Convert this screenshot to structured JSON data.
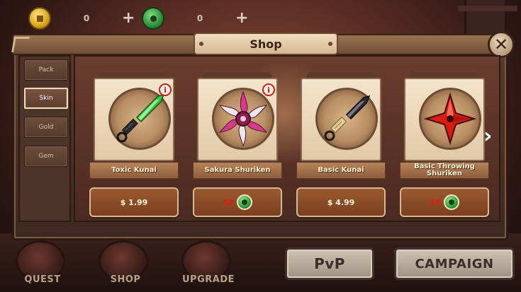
{
  "resources": {
    "coins": "0",
    "gems": "0",
    "coin_icon": "gold-coin-icon",
    "gem_icon": "jade-coin-icon",
    "plus": "+"
  },
  "shop": {
    "title": "Shop",
    "close": "✕",
    "tabs": [
      {
        "label": "Pack",
        "active": false
      },
      {
        "label": "Skin",
        "active": true
      },
      {
        "label": "Gold",
        "active": false
      },
      {
        "label": "Gem",
        "active": false
      }
    ],
    "items": [
      {
        "name": "Toxic Kunai",
        "price": "$ 1.99",
        "currency": "usd",
        "info": "i",
        "icon": "toxic-kunai-icon"
      },
      {
        "name": "Sakura Shuriken",
        "price": "50",
        "currency": "jade",
        "info": "i",
        "icon": "sakura-shuriken-icon"
      },
      {
        "name": "Basic Kunai",
        "price": "$ 4.99",
        "currency": "usd",
        "icon": "basic-kunai-icon"
      },
      {
        "name": "Basic Throwing Shuriken",
        "price": "25",
        "currency": "jade",
        "icon": "basic-shuriken-icon"
      }
    ],
    "next_arrow": "›"
  },
  "nav": {
    "quest": "QUEST",
    "shop": "SHOP",
    "upgrade": "UPGRADE",
    "pvp": "PvP",
    "campaign": "CAMPAIGN"
  },
  "colors": {
    "accent_red": "#e01c12",
    "panel_brown": "#5a3a2c",
    "parchment": "#f4e4cc"
  }
}
